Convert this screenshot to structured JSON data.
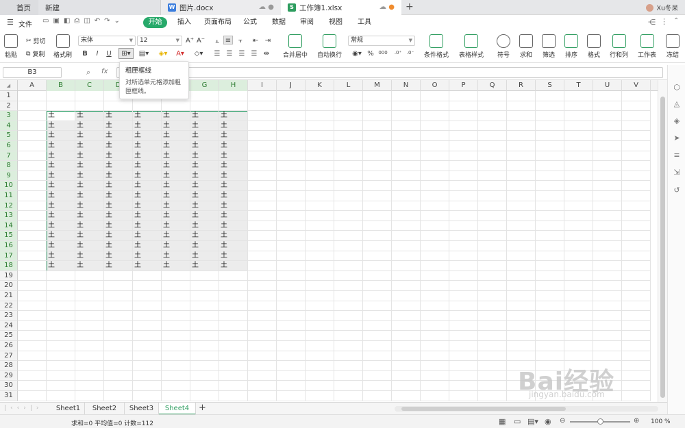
{
  "tabs": {
    "home": "首页",
    "new": "新建",
    "doc1": "图片.docx",
    "doc2": "工作簿1.xlsx",
    "add": "+",
    "user": "Xu冬呆"
  },
  "menu": {
    "file": "文件",
    "tabs": [
      "开始",
      "插入",
      "页面布局",
      "公式",
      "数据",
      "审阅",
      "视图",
      "工具"
    ],
    "active": "开始"
  },
  "ribbon": {
    "paste": "粘贴",
    "cut": "剪切",
    "copy": "复制",
    "format_painter": "格式刷",
    "font_name": "宋体",
    "font_size": "12",
    "bold": "B",
    "italic": "I",
    "underline": "U",
    "merge_center": "合并居中",
    "wrap_text": "自动换行",
    "number_format": "常规",
    "percent": "%",
    "cond_format": "条件格式",
    "table_style": "表格样式",
    "symbol": "符号",
    "sum": "求和",
    "filter": "筛选",
    "sort": "排序",
    "format": "格式",
    "row_col": "行和列",
    "worksheet": "工作表",
    "freeze": "冻结"
  },
  "formula_bar": {
    "name_box": "B3",
    "fx": "fx"
  },
  "tooltip": {
    "title": "粗匣框线",
    "desc": "对所选单元格添加粗匣框线。"
  },
  "columns": [
    "A",
    "B",
    "C",
    "D",
    "E",
    "F",
    "G",
    "H",
    "I",
    "J",
    "K",
    "L",
    "M",
    "N",
    "O",
    "P",
    "Q",
    "R",
    "S",
    "T",
    "U",
    "V"
  ],
  "rows": [
    "1",
    "2",
    "3",
    "4",
    "5",
    "6",
    "7",
    "8",
    "9",
    "10",
    "11",
    "12",
    "13",
    "14",
    "15",
    "16",
    "17",
    "18",
    "19",
    "20",
    "21",
    "22",
    "23",
    "24",
    "25",
    "26",
    "27",
    "28",
    "29",
    "30",
    "31"
  ],
  "cell_value": "土",
  "sheets": [
    "Sheet1",
    "Sheet2",
    "Sheet3",
    "Sheet4"
  ],
  "active_sheet": "Sheet4",
  "status": {
    "stats": "求和=0  平均值=0  计数=112",
    "zoom": "100 %"
  },
  "watermark": {
    "brand": "Bai经验",
    "url": "jingyan.baidu.com"
  }
}
